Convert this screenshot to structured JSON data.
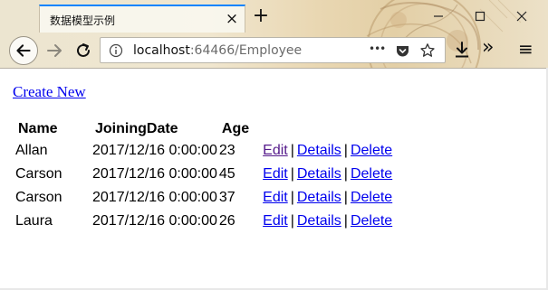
{
  "browser": {
    "tab_title": "数据模型示例",
    "tab_close": "×",
    "new_tab": "+",
    "url_host": "localhost",
    "url_path": ":64466/Employee",
    "more_glyph": "•••",
    "overflow_glyph": "»",
    "menu_glyph": "≡"
  },
  "page": {
    "create_new": "Create New",
    "table": {
      "headers": [
        "Name",
        "JoiningDate",
        "Age"
      ],
      "rows": [
        {
          "name": "Allan",
          "joining_date": "2017/12/16 0:00:00",
          "age": "23"
        },
        {
          "name": "Carson",
          "joining_date": "2017/12/16 0:00:00",
          "age": "45"
        },
        {
          "name": "Carson",
          "joining_date": "2017/12/16 0:00:00",
          "age": "37"
        },
        {
          "name": "Laura",
          "joining_date": "2017/12/16 0:00:00",
          "age": "26"
        }
      ],
      "actions": {
        "edit": "Edit",
        "details": "Details",
        "delete": "Delete",
        "separator": "|"
      }
    }
  },
  "colors": {
    "link": "#0000ee",
    "visited_link": "#551a8b",
    "active_tab_accent": "#0a84ff"
  }
}
